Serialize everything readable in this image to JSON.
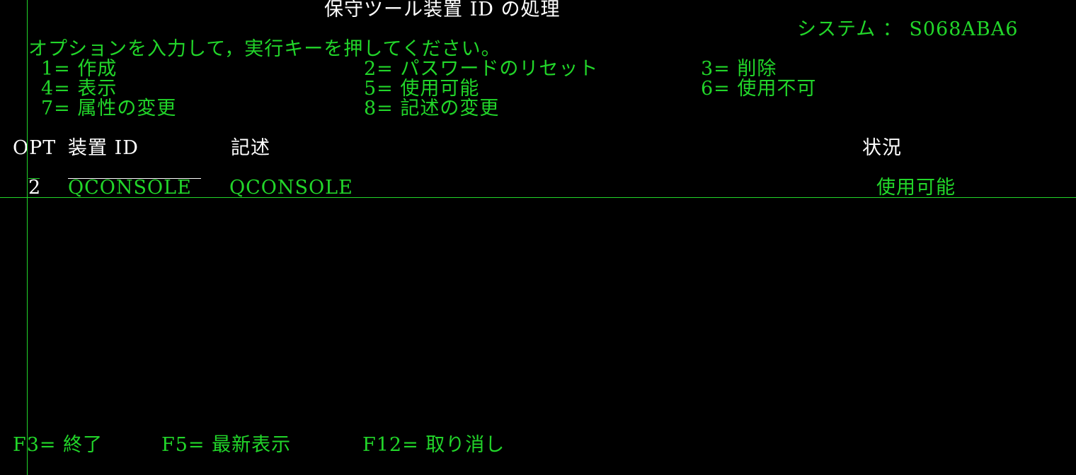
{
  "screen": {
    "title": "保守ツール装置 ID の処理",
    "system_label": "システム ： S068ABA6"
  },
  "instructions": "オプションを入力して，実行キーを押してください。",
  "options": [
    {
      "label": "1= 作成"
    },
    {
      "label": "2= パスワードのリセット"
    },
    {
      "label": "3= 削除"
    },
    {
      "label": "4= 表示"
    },
    {
      "label": "5= 使用可能"
    },
    {
      "label": "6= 使用不可"
    },
    {
      "label": "7= 属性の変更"
    },
    {
      "label": "8= 記述の変更"
    }
  ],
  "table": {
    "headers": {
      "opt": "OPT",
      "device_id": "装置 ID",
      "description": "記述",
      "status": "状況"
    },
    "rows": [
      {
        "opt": "2",
        "device_id": "QCONSOLE",
        "description": "QCONSOLE",
        "status": "使用可能"
      }
    ]
  },
  "function_keys": [
    {
      "label": "F3= 終了"
    },
    {
      "label": "F5= 最新表示"
    },
    {
      "label": "F12= 取り消し"
    }
  ],
  "colors": {
    "background": "#000000",
    "text_green": "#22d62a",
    "text_white": "#ffffff"
  }
}
